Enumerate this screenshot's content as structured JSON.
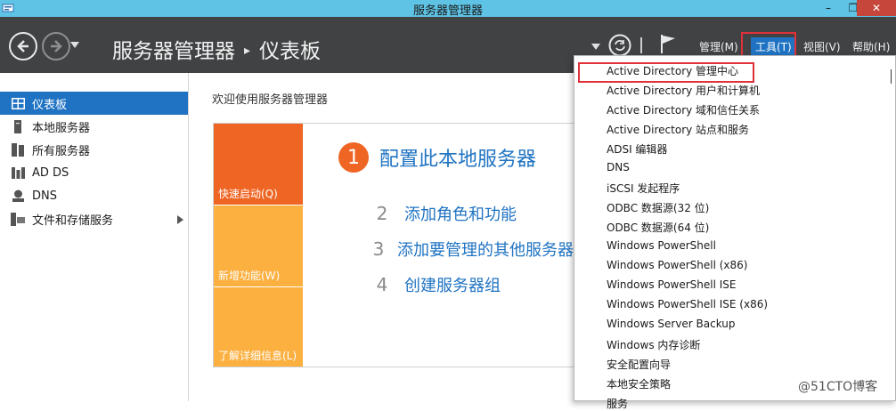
{
  "window": {
    "title": "服务器管理器",
    "minimize": "–",
    "restore": "❐",
    "close": "✕"
  },
  "header": {
    "breadcrumb_root": "服务器管理器",
    "breadcrumb_sep": "▸",
    "breadcrumb_page": "仪表板",
    "menus": [
      "管理(M)",
      "工具(T)",
      "视图(V)",
      "帮助(H)"
    ],
    "active_menu_index": 1
  },
  "sidebar": {
    "items": [
      {
        "label": "仪表板",
        "icon": "dashboard-icon",
        "selected": true
      },
      {
        "label": "本地服务器",
        "icon": "server-icon",
        "selected": false
      },
      {
        "label": "所有服务器",
        "icon": "servers-icon",
        "selected": false
      },
      {
        "label": "AD DS",
        "icon": "ad-ds-icon",
        "selected": false
      },
      {
        "label": "DNS",
        "icon": "dns-icon",
        "selected": false
      },
      {
        "label": "文件和存储服务",
        "icon": "file-storage-icon",
        "selected": false,
        "has_arrow": true
      }
    ]
  },
  "main": {
    "welcome_title": "欢迎使用服务器管理器",
    "tiles": [
      "快速启动(Q)",
      "新增功能(W)",
      "了解详细信息(L)"
    ],
    "steps": [
      {
        "num": "1",
        "label": "配置此本地服务器"
      },
      {
        "num": "2",
        "label": "添加角色和功能"
      },
      {
        "num": "3",
        "label": "添加要管理的其他服务器"
      },
      {
        "num": "4",
        "label": "创建服务器组"
      }
    ]
  },
  "tools_menu": {
    "items": [
      "Active Directory 管理中心",
      "Active Directory 用户和计算机",
      "Active Directory 域和信任关系",
      "Active Directory 站点和服务",
      "ADSI 编辑器",
      "DNS",
      "iSCSI 发起程序",
      "ODBC 数据源(32 位)",
      "ODBC 数据源(64 位)",
      "Windows PowerShell",
      "Windows PowerShell (x86)",
      "Windows PowerShell ISE",
      "Windows PowerShell ISE (x86)",
      "Windows Server Backup",
      "Windows 内存诊断",
      "安全配置向导",
      "本地安全策略",
      "服务"
    ],
    "highlighted_index": 0
  },
  "watermark": "@51CTO博客",
  "colors": {
    "title_bar": "#5ec3e4",
    "header": "#404244",
    "selection": "#1f73c2",
    "tile_orange": "#ef6523",
    "tile_light": "#fbb040",
    "highlight_box": "#e0303a"
  }
}
